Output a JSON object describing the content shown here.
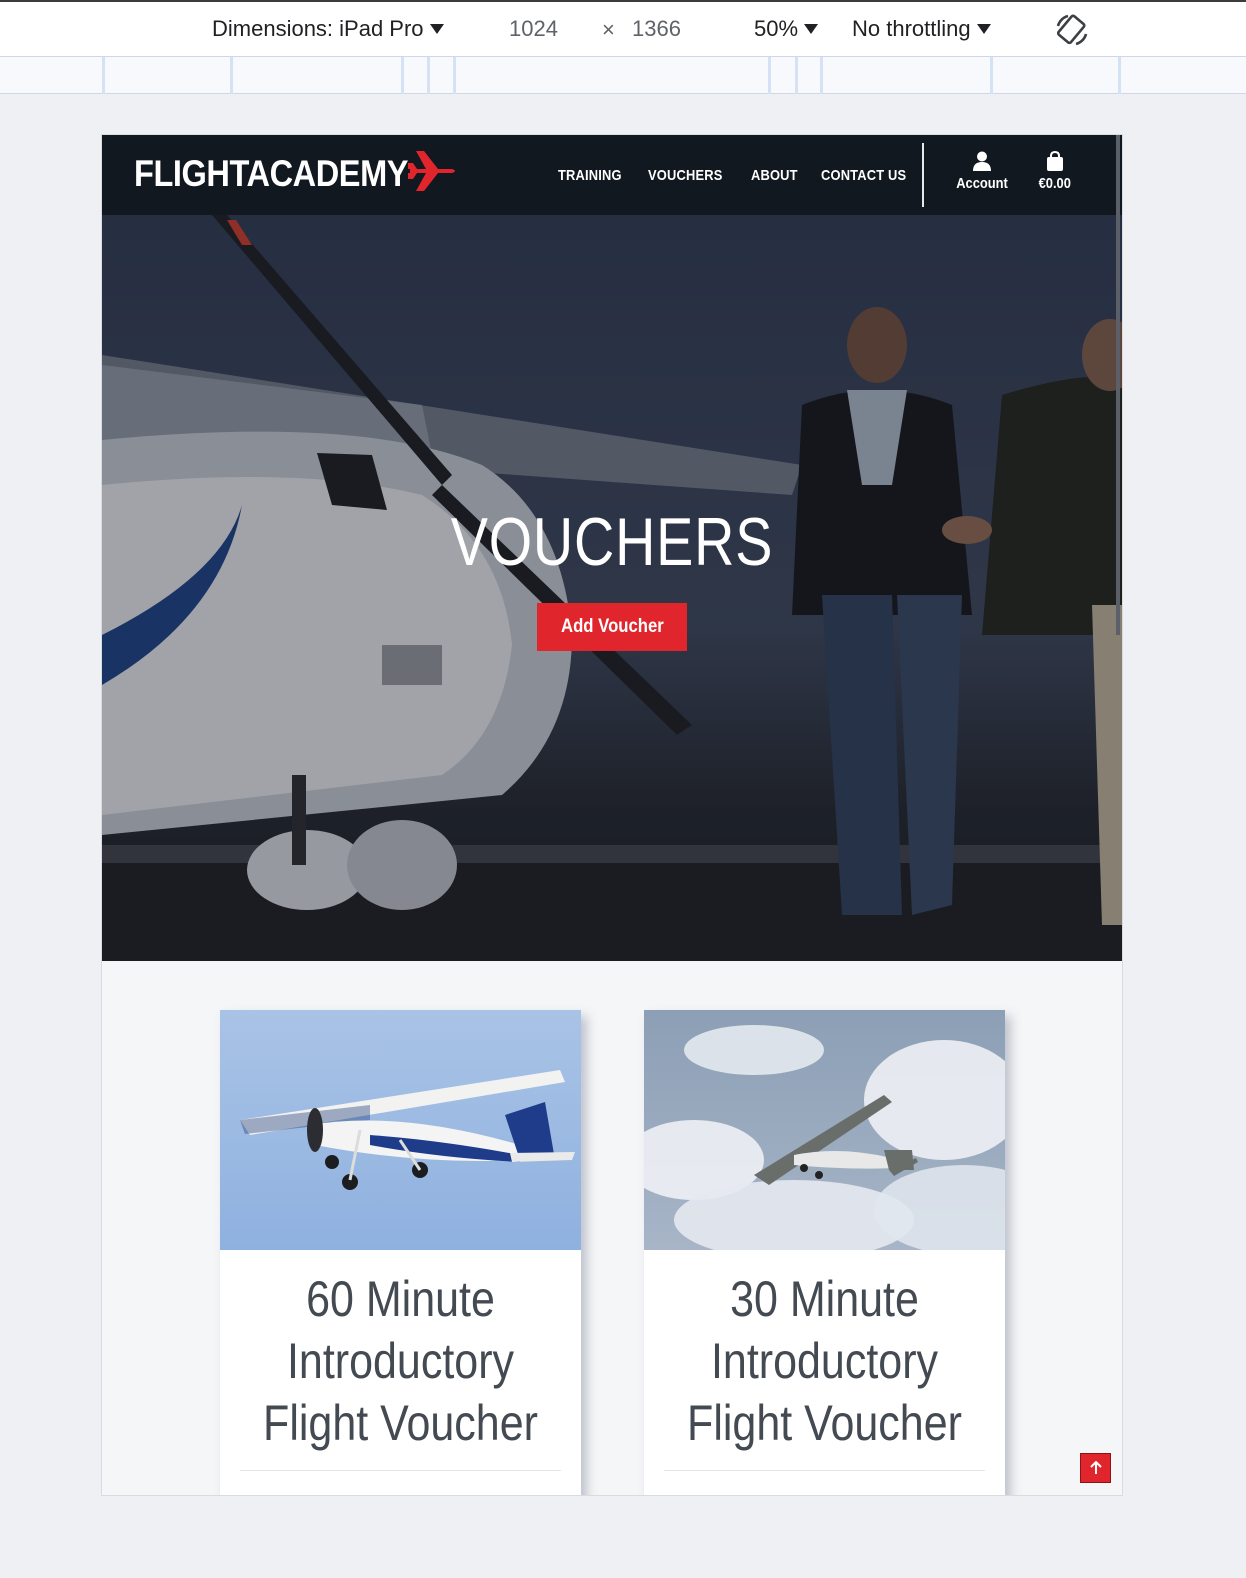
{
  "devtools": {
    "dimensions_label": "Dimensions: iPad Pro",
    "width": "1024",
    "times": "×",
    "height": "1366",
    "zoom": "50%",
    "throttling": "No throttling",
    "icons": [
      "caret-down-icon",
      "rotate-icon"
    ]
  },
  "nav": {
    "logo": "FLIGHTACADEMY",
    "logo_icon": "airplane-icon",
    "brand_color": "#e0262c",
    "menu": [
      {
        "label": "TRAINING"
      },
      {
        "label": "VOUCHERS"
      },
      {
        "label": "ABOUT"
      },
      {
        "label": "CONTACT US"
      }
    ],
    "account_label": "Account",
    "account_icon": "user-icon",
    "cart_label": "€0.00",
    "cart_icon": "shopping-bag-icon"
  },
  "hero": {
    "title": "VOUCHERS",
    "button_label": "Add Voucher"
  },
  "cards": [
    {
      "title_lines": [
        "60 Minute",
        "Introductory",
        "Flight Voucher"
      ],
      "image": "plane-flying-blue-sky-photo"
    },
    {
      "title_lines": [
        "30 Minute",
        "Introductory",
        "Flight Voucher"
      ],
      "image": "plane-flying-cloudy-sky-photo"
    }
  ],
  "back_to_top_icon": "arrow-up-icon"
}
